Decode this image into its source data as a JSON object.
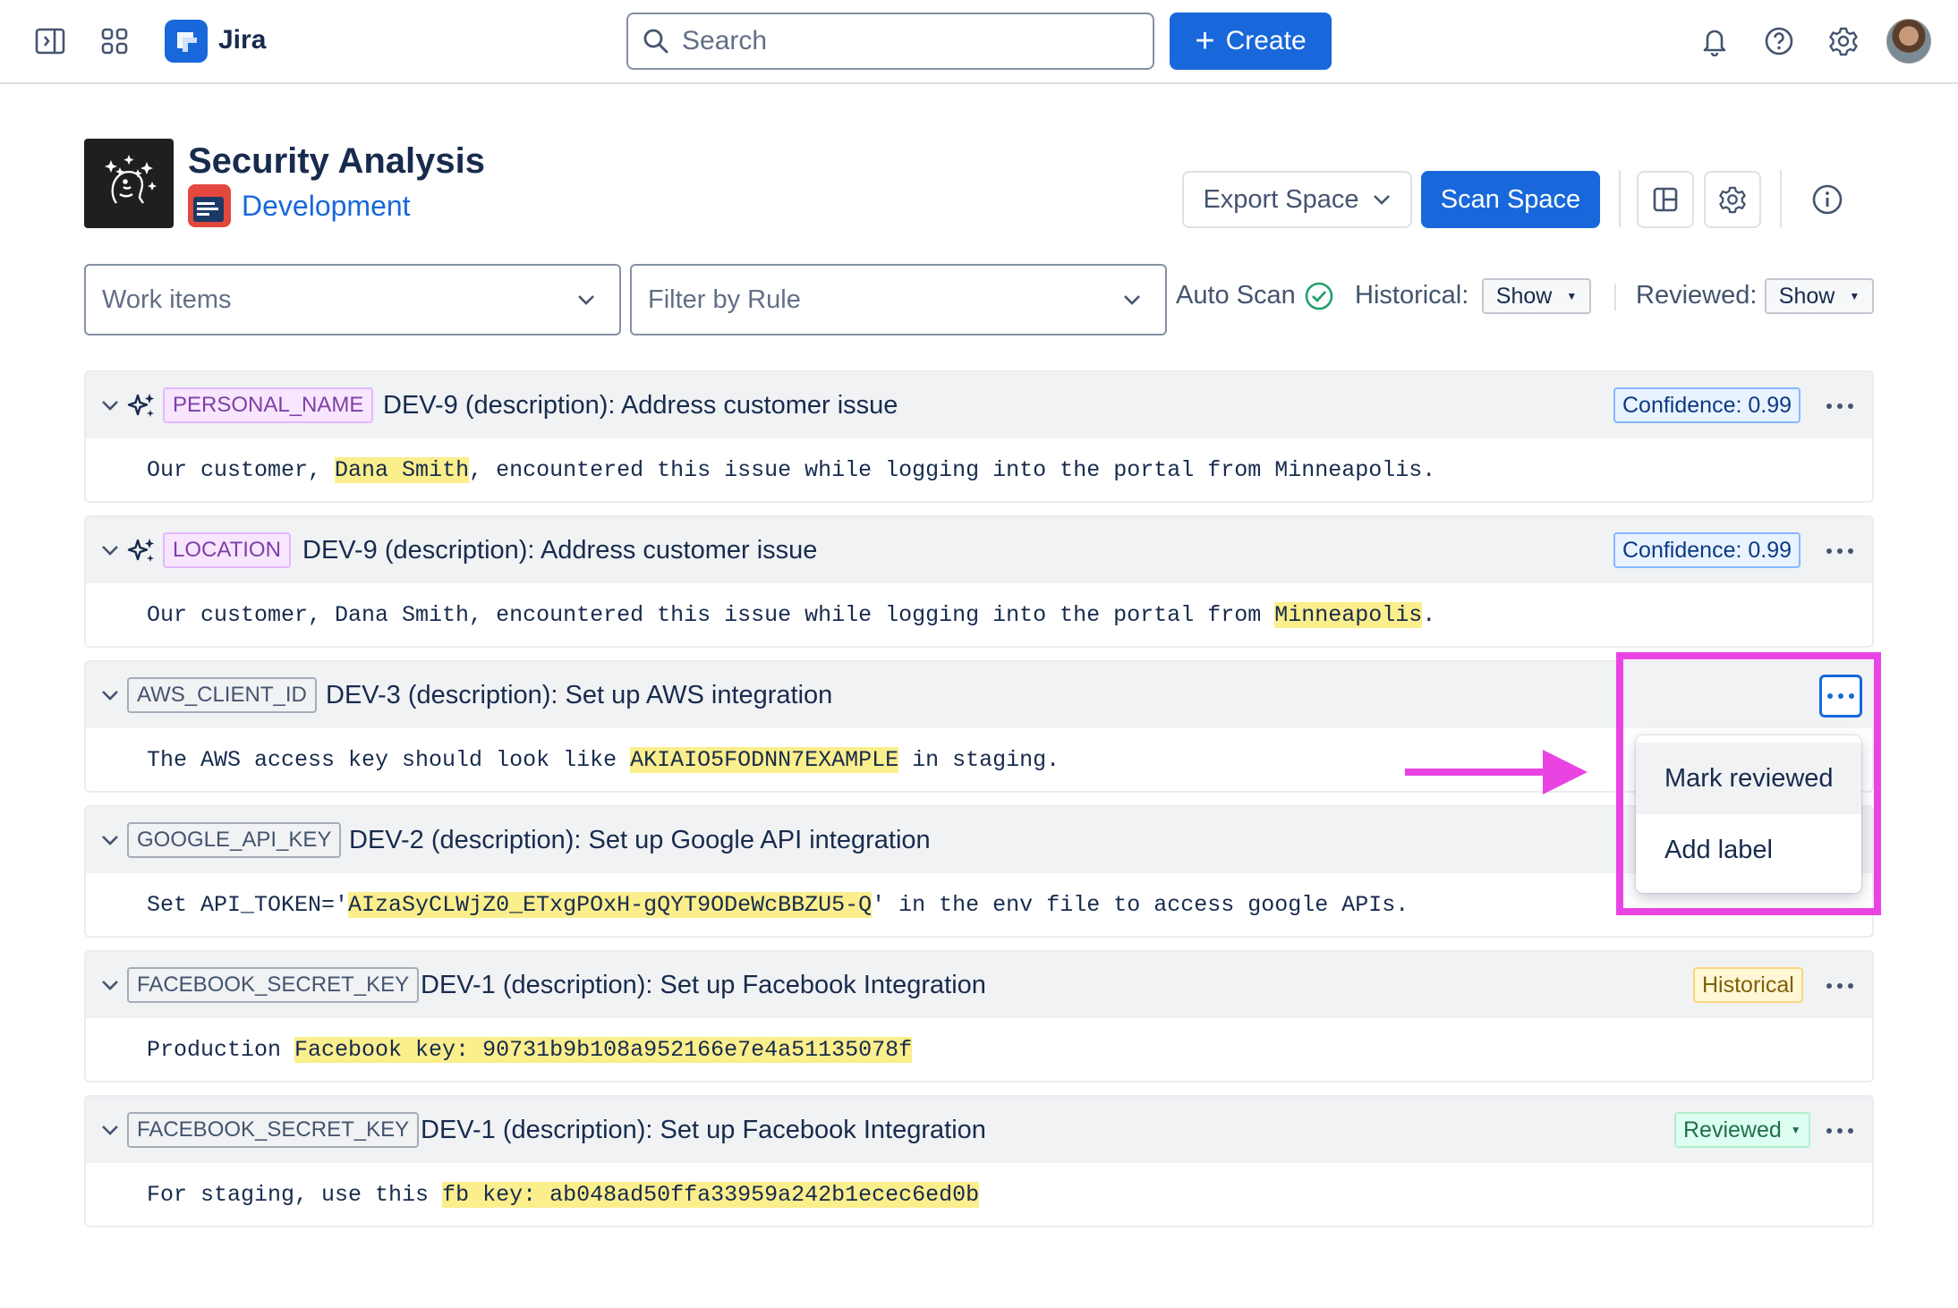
{
  "topbar": {
    "app_name": "Jira",
    "search_placeholder": "Search",
    "create_label": "Create",
    "icons": [
      "sidebar-toggle-icon",
      "app-switcher-icon",
      "jira-logo-icon",
      "search-icon",
      "bell-icon",
      "help-icon",
      "settings-icon"
    ]
  },
  "header": {
    "title": "Security Analysis",
    "space_name": "Development",
    "export_label": "Export Space",
    "scan_label": "Scan Space"
  },
  "filters": {
    "work_items_placeholder": "Work items",
    "rule_placeholder": "Filter by Rule",
    "auto_scan_label": "Auto Scan",
    "historical_label": "Historical:",
    "historical_value": "Show",
    "reviewed_label": "Reviewed:",
    "reviewed_value": "Show"
  },
  "results": [
    {
      "tag": "PERSONAL_NAME",
      "title": "DEV-9 (description): Address customer issue",
      "badge": "Confidence: 0.99",
      "text_before": "Our customer, ",
      "highlight": "Dana Smith",
      "text_after": ", encountered this issue while logging into the portal from Minneapolis."
    },
    {
      "tag": "LOCATION",
      "title": "DEV-9 (description): Address customer issue",
      "badge": "Confidence: 0.99",
      "text_before": "Our customer, Dana Smith, encountered this issue while logging into the portal from ",
      "highlight": "Minneapolis",
      "text_after": "."
    },
    {
      "tag": "AWS_CLIENT_ID",
      "title": "DEV-3 (description): Set up AWS integration",
      "text_before": "The AWS access key should look like ",
      "highlight": "AKIAIO5FODNN7EXAMPLE",
      "text_after": " in staging."
    },
    {
      "tag": "GOOGLE_API_KEY",
      "title": "DEV-2 (description): Set up Google API integration",
      "text_before": "Set API_TOKEN='",
      "highlight": "AIzaSyCLWjZ0_ETxgPOxH-gQYT9ODeWcBBZU5-Q",
      "text_after": "' in the env file to access google APIs."
    },
    {
      "tag": "FACEBOOK_SECRET_KEY",
      "title": "DEV-1 (description): Set up Facebook Integration",
      "badge": "Historical",
      "text_before": "Production ",
      "highlight": "Facebook key: 90731b9b108a952166e7e4a51135078f",
      "text_after": ""
    },
    {
      "tag": "FACEBOOK_SECRET_KEY",
      "title": "DEV-1 (description): Set up Facebook Integration",
      "badge": "Reviewed",
      "text_before": "For staging, use this ",
      "highlight": "fb key: ab048ad50ffa33959a242b1ecec6ed0b",
      "text_after": ""
    }
  ],
  "menu": {
    "items": [
      "Mark reviewed",
      "Add label"
    ]
  },
  "colors": {
    "brand_blue": "#1868db",
    "annotation_magenta": "#e944e3",
    "highlight_yellow": "#fbee8c",
    "ai_tag_purple": "#803fa5"
  }
}
